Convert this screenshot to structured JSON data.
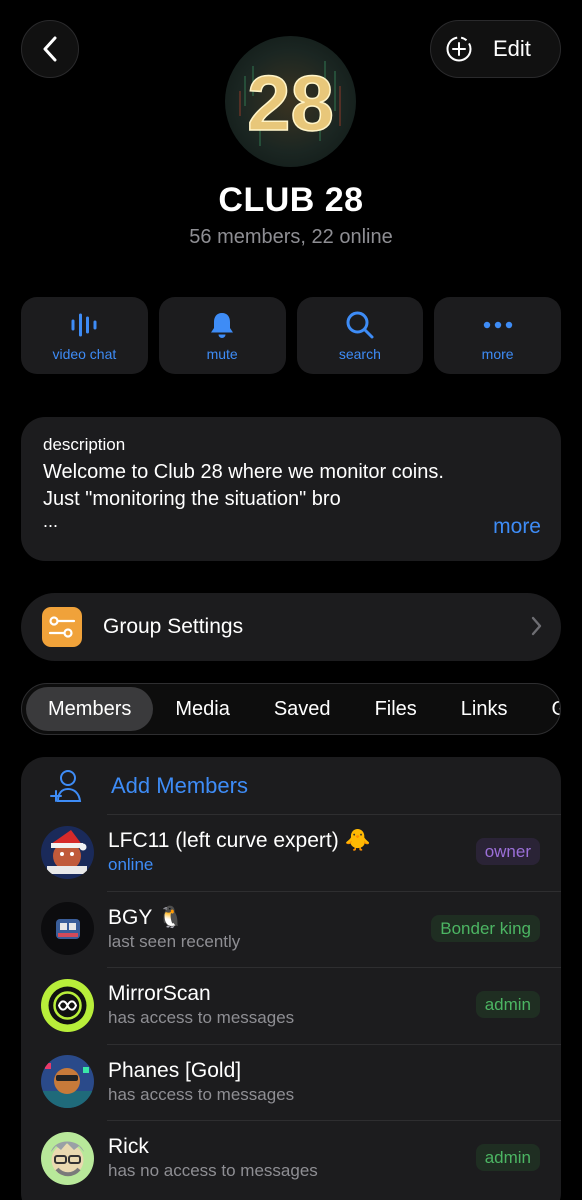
{
  "header": {
    "edit_label": "Edit",
    "back_icon": "chevron-left-icon",
    "story_icon": "plus-circle-dashed-icon"
  },
  "group": {
    "avatar_text": "28",
    "title": "CLUB 28",
    "subtitle": "56 members, 22 online"
  },
  "actions": [
    {
      "label": "video chat",
      "icon": "voice-waves-icon"
    },
    {
      "label": "mute",
      "icon": "bell-icon"
    },
    {
      "label": "search",
      "icon": "search-icon"
    },
    {
      "label": "more",
      "icon": "ellipsis-icon"
    }
  ],
  "description": {
    "header": "description",
    "line1": "Welcome to Club 28 where we monitor coins.",
    "line2": "Just \"monitoring the situation\" bro",
    "ellipsis": "...",
    "more_label": "more"
  },
  "settings": {
    "label": "Group Settings",
    "icon": "sliders-icon",
    "icon_color": "#f0a23a"
  },
  "tabs": [
    "Members",
    "Media",
    "Saved",
    "Files",
    "Links",
    "G"
  ],
  "active_tab": "Members",
  "members_section": {
    "add_label": "Add Members",
    "items": [
      {
        "name": "LFC11 (left curve expert) 🐥",
        "status": "online",
        "badge": "owner"
      },
      {
        "name": "BGY 🐧",
        "status": "last seen recently",
        "badge": "Bonder king"
      },
      {
        "name": "MirrorScan",
        "status": "has access to messages",
        "badge": "admin"
      },
      {
        "name": "Phanes [Gold]",
        "status": "has access to messages",
        "badge": ""
      },
      {
        "name": "Rick",
        "status": "has no access to messages",
        "badge": "admin"
      }
    ]
  },
  "colors": {
    "accent": "#3e8cf6",
    "card": "#1c1c1e",
    "owner_badge": "#9b6fd8",
    "admin_badge": "#4cb563"
  }
}
